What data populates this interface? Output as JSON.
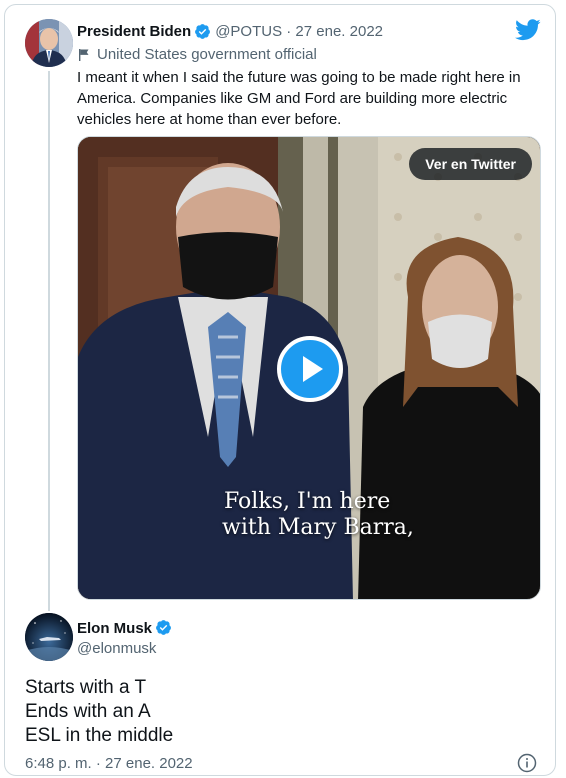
{
  "quoted": {
    "name": "President Biden",
    "handle_date": "@POTUS · 27 ene. 2022",
    "label": "United States government official",
    "text": "I meant it when I said the future was going to be made right here in America. Companies like GM and Ford are building more electric vehicles here at home than ever before.",
    "view_button": "Ver en Twitter",
    "caption_lines": [
      "Folks, I'm here",
      "with Mary Barra,"
    ]
  },
  "tweet": {
    "name": "Elon Musk",
    "handle": "@elonmusk",
    "lines": [
      "Starts with a T",
      "Ends with an A",
      "ESL in the middle"
    ],
    "meta": "6:48 p. m. · 27 ene. 2022"
  },
  "colors": {
    "accent": "#1d9bf0",
    "secondary_text": "#536471",
    "border": "#cfd9de"
  },
  "icons": {
    "brand": "twitter-bird-icon",
    "verified": "verified-badge-icon",
    "label": "government-flag-icon",
    "play": "play-icon",
    "info": "info-icon"
  }
}
